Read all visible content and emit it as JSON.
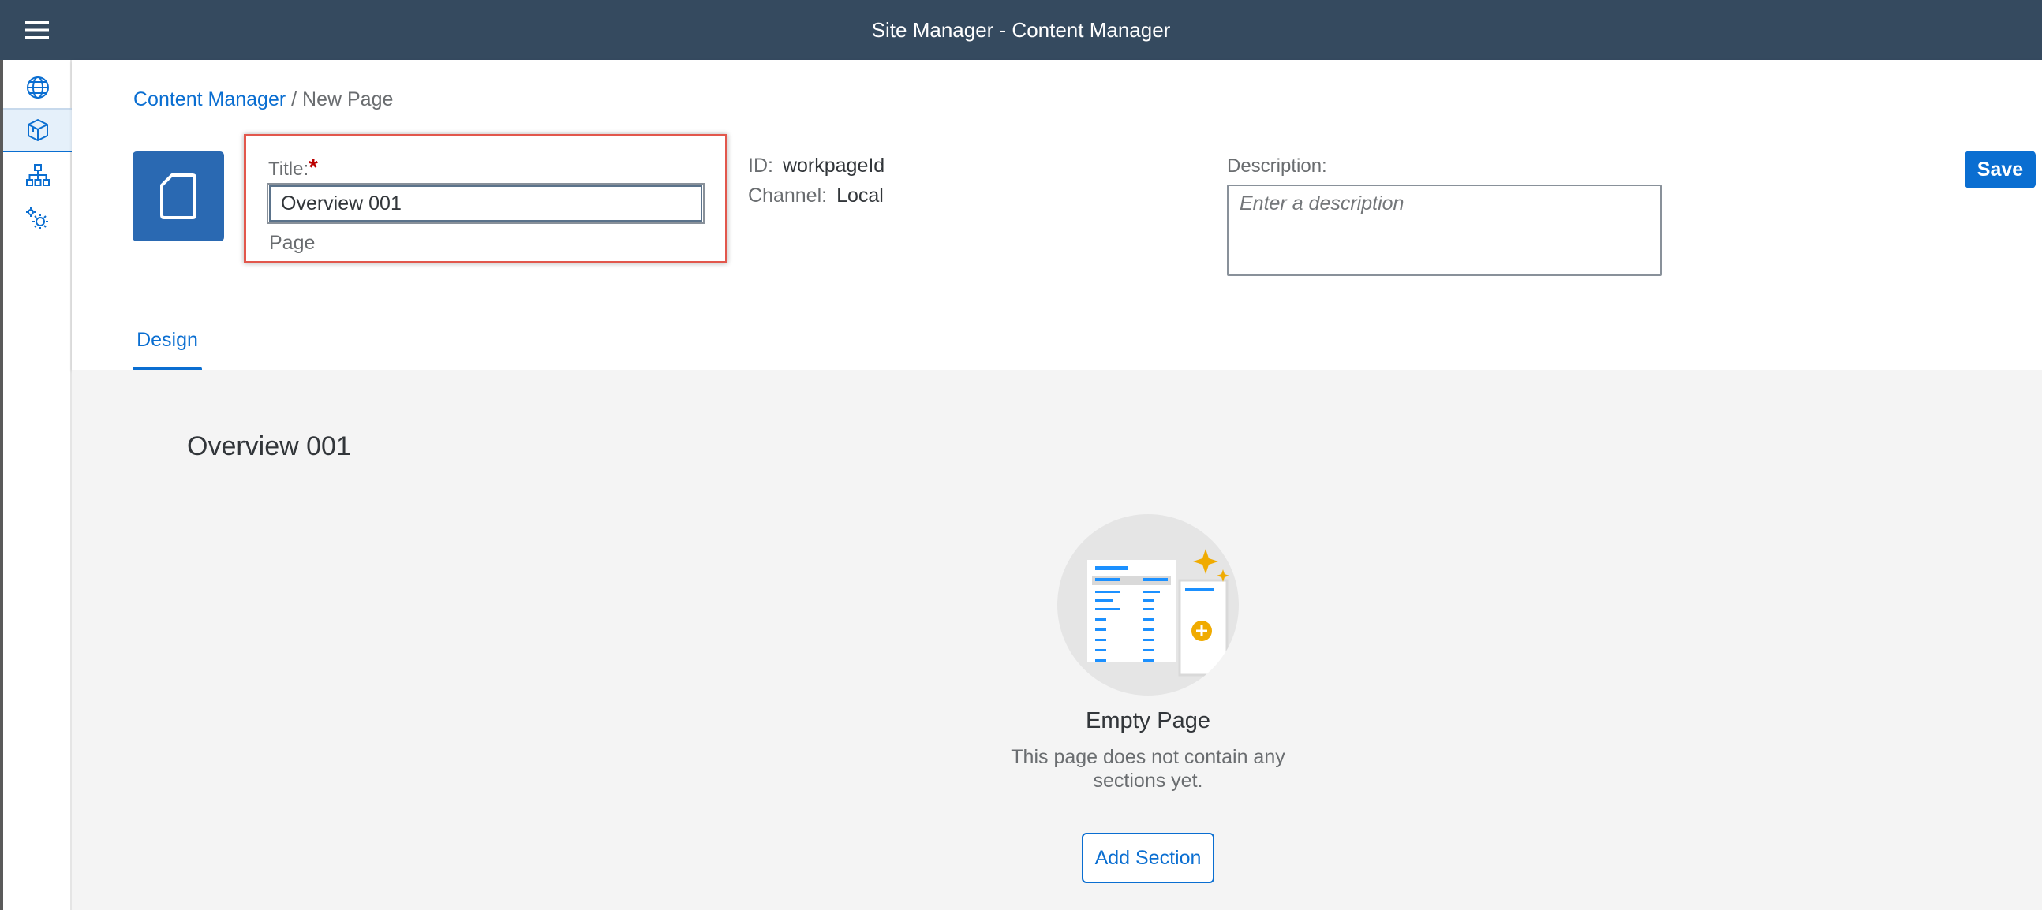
{
  "shell": {
    "title": "Site Manager - Content Manager"
  },
  "side_nav": {
    "items": [
      {
        "icon": "globe-icon",
        "active": false
      },
      {
        "icon": "cube-icon",
        "active": true
      },
      {
        "icon": "hierarchy-icon",
        "active": false
      },
      {
        "icon": "gears-icon",
        "active": false
      }
    ]
  },
  "breadcrumb": {
    "link": "Content Manager",
    "separator": "/",
    "current": "New Page"
  },
  "form": {
    "title_label": "Title:",
    "required_marker": "*",
    "title_value": "Overview 001",
    "type_label": "Page",
    "id_label": "ID:",
    "id_value": "workpageId",
    "channel_label": "Channel:",
    "channel_value": "Local",
    "description_label": "Description:",
    "description_placeholder": "Enter a description",
    "save_label": "Save"
  },
  "tabs": [
    {
      "label": "Design",
      "selected": true
    }
  ],
  "content": {
    "page_heading": "Overview 001",
    "empty_title": "Empty Page",
    "empty_text": "This page does not contain any sections yet.",
    "add_section_label": "Add Section"
  },
  "colors": {
    "shell_bg": "#354a5f",
    "accent": "#0a6ed1",
    "highlight": "#e2574c",
    "page_icon_bg": "#2a69b2",
    "illustration_yellow": "#f0ab00"
  }
}
